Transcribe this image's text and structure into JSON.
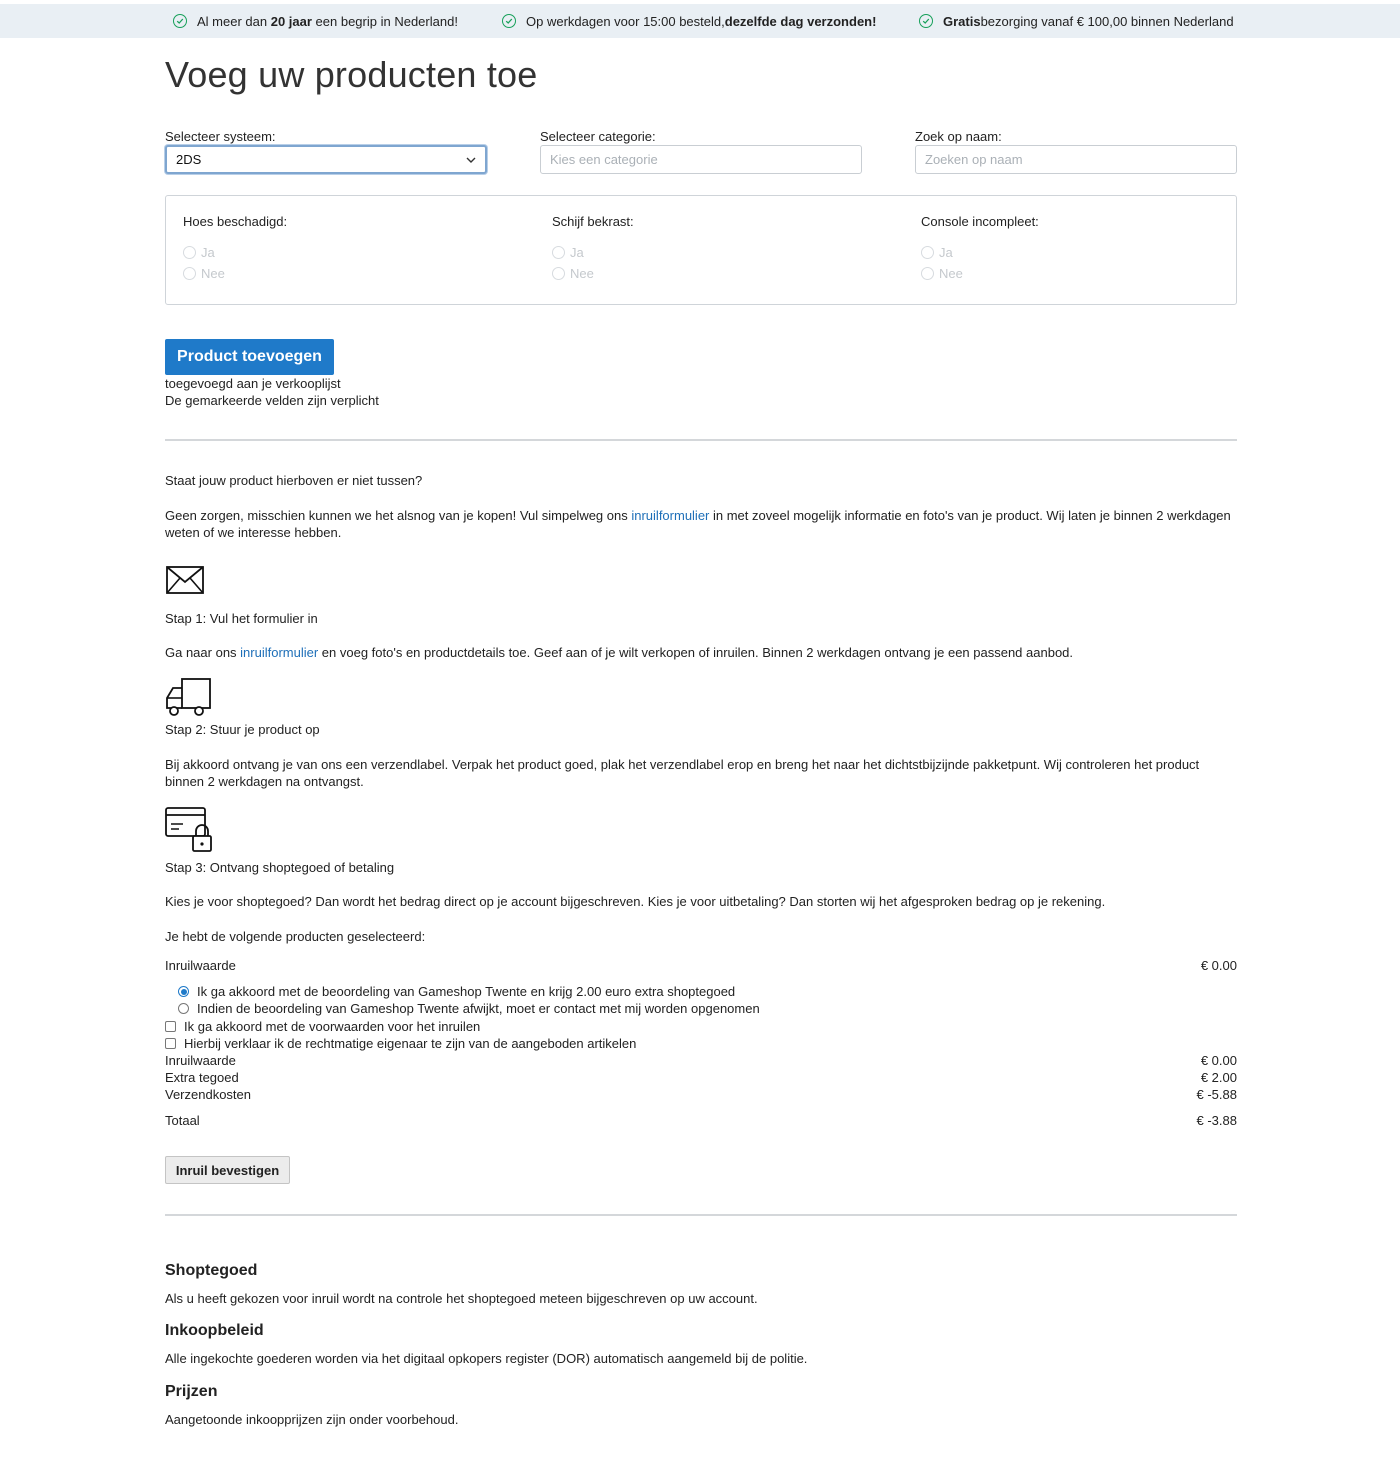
{
  "usp_bar": {
    "items": [
      {
        "pre": "Al meer dan ",
        "bold": "20 jaar",
        "post": " een begrip in Nederland!"
      },
      {
        "pre": "Op werkdagen voor 15:00 besteld, ",
        "bold": "dezelfde dag verzonden!",
        "post": ""
      },
      {
        "pre": "",
        "bold": "Gratis",
        "post": " bezorging vanaf € 100,00 binnen Nederland"
      }
    ]
  },
  "page": {
    "title": "Voeg uw producten toe"
  },
  "filters": {
    "system_label": "Selecteer systeem:",
    "system_value": "2DS",
    "category_label": "Selecteer categorie:",
    "category_placeholder": "Kies een categorie",
    "search_label": "Zoek op naam:",
    "search_placeholder": "Zoeken op naam"
  },
  "conditions": [
    {
      "title": "Hoes beschadigd:",
      "yes": "Ja",
      "no": "Nee"
    },
    {
      "title": "Schijf bekrast:",
      "yes": "Ja",
      "no": "Nee"
    },
    {
      "title": "Console incompleet:",
      "yes": "Ja",
      "no": "Nee"
    }
  ],
  "add": {
    "button_label": "Product toevoegen",
    "added_note": "toegevoegd aan je verkooplijst",
    "required_note": "De gemarkeerde velden zijn verplicht"
  },
  "info": {
    "question": "Staat jouw product hierboven er niet tussen?",
    "intro_pre": "Geen zorgen, misschien kunnen we het alsnog van je kopen! Vul simpelweg ons ",
    "intro_link": "inruilformulier",
    "intro_post": " in met zoveel mogelijk informatie en foto's van je product. Wij laten je binnen 2 werkdagen weten of we interesse hebben.",
    "step1_title": "Stap 1: Vul het formulier in",
    "step1_pre": "Ga naar ons ",
    "step1_link": "inruilformulier",
    "step1_post": " en voeg foto's en productdetails toe. Geef aan of je wilt verkopen of inruilen. Binnen 2 werkdagen ontvang je een passend aanbod.",
    "step2_title": "Stap 2: Stuur je product op",
    "step2_text": "Bij akkoord ontvang je van ons een verzendlabel. Verpak het product goed, plak het verzendlabel erop en breng het naar het dichtstbijzijnde pakketpunt. Wij controleren het product binnen 2 werkdagen na ontvangst.",
    "step3_title": "Stap 3: Ontvang shoptegoed of betaling",
    "step3_text": "Kies je voor shoptegoed? Dan wordt het bedrag direct op je account bijgeschreven. Kies je voor uitbetaling? Dan storten wij het afgesproken bedrag op je rekening."
  },
  "summary": {
    "selected_intro": "Je hebt de volgende producten geselecteerd:",
    "trade_value_label": "Inruilwaarde",
    "trade_value": "€ 0.00",
    "option_agree": "Ik ga akkoord met de beoordeling van Gameshop Twente en krijg 2.00 euro extra shoptegoed",
    "option_contact": "Indien de beoordeling van Gameshop Twente afwijkt, moet er contact met mij worden opgenomen",
    "check_terms": "Ik ga akkoord met de voorwaarden voor het inruilen",
    "check_owner": "Hierbij verklaar ik de rechtmatige eigenaar te zijn van de aangeboden artikelen",
    "lines": [
      {
        "label": "Inruilwaarde",
        "value": "€  0.00"
      },
      {
        "label": "Extra tegoed",
        "value": "€  2.00"
      },
      {
        "label": "Verzendkosten",
        "value": "€  -5.88"
      }
    ],
    "total_label": "Totaal",
    "total_value": "€  -3.88",
    "confirm_button": "Inruil bevestigen"
  },
  "footer_info": {
    "credit_title": "Shoptegoed",
    "credit_text": "Als u heeft gekozen voor inruil wordt na controle het shoptegoed meteen bijgeschreven op uw account.",
    "policy_title": "Inkoopbeleid",
    "policy_text": "Alle ingekochte goederen worden via het digitaal opkopers register (DOR) automatisch aangemeld bij de politie.",
    "prices_title": "Prijzen",
    "prices_text": "Aangetoonde inkoopprijzen zijn onder voorbehoud."
  },
  "colors": {
    "accent": "#1f7ac9",
    "link": "#1e6fb8",
    "check_green": "#17a05a",
    "topbar_bg": "#e9eff4"
  }
}
